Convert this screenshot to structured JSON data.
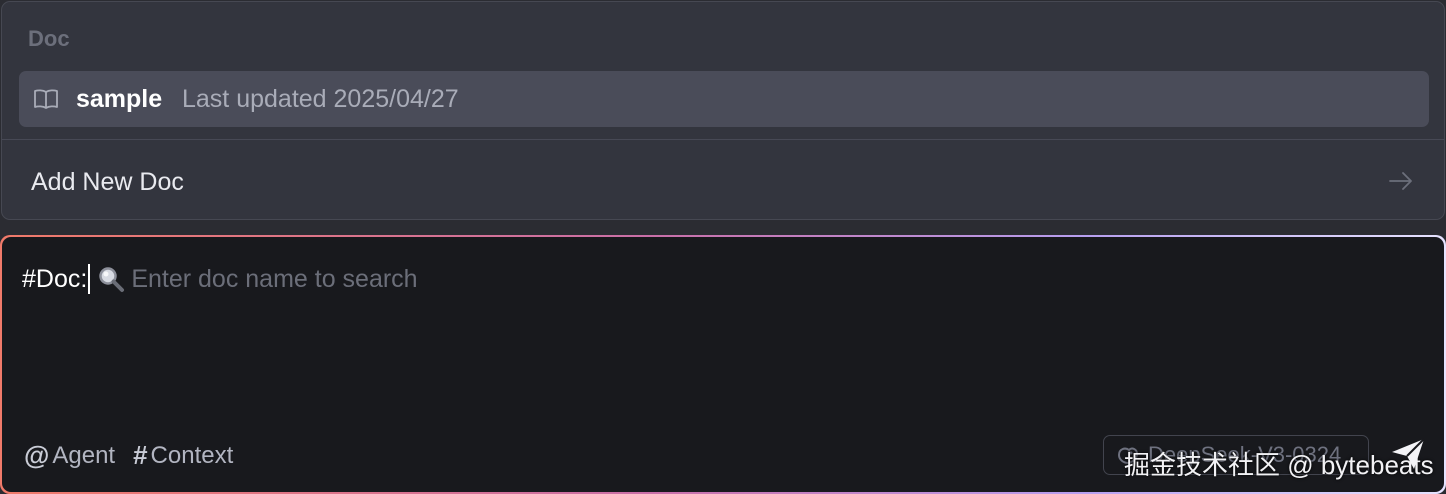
{
  "doc_panel": {
    "heading": "Doc",
    "items": [
      {
        "name": "sample",
        "updated": "Last updated 2025/04/27",
        "icon": "book-icon"
      }
    ],
    "add_label": "Add New Doc",
    "add_icon": "arrow-right-icon"
  },
  "input": {
    "tag": "#Doc:",
    "placeholder": "Enter doc name to search",
    "search_icon": "search-icon"
  },
  "footer": {
    "agent_glyph": "@",
    "agent_label": "Agent",
    "context_glyph": "#",
    "context_label": "Context",
    "model_name": "DeepSeek-V3-0324",
    "send_icon": "send-icon"
  },
  "watermark": "掘金技术社区 @ bytebeats",
  "colors": {
    "panel_bg": "#33353e",
    "selected_item_bg": "#4a4c59",
    "input_bg": "#18191d",
    "border_gradient_start": "#f07a6a",
    "border_gradient_end": "#e6e3ff"
  }
}
